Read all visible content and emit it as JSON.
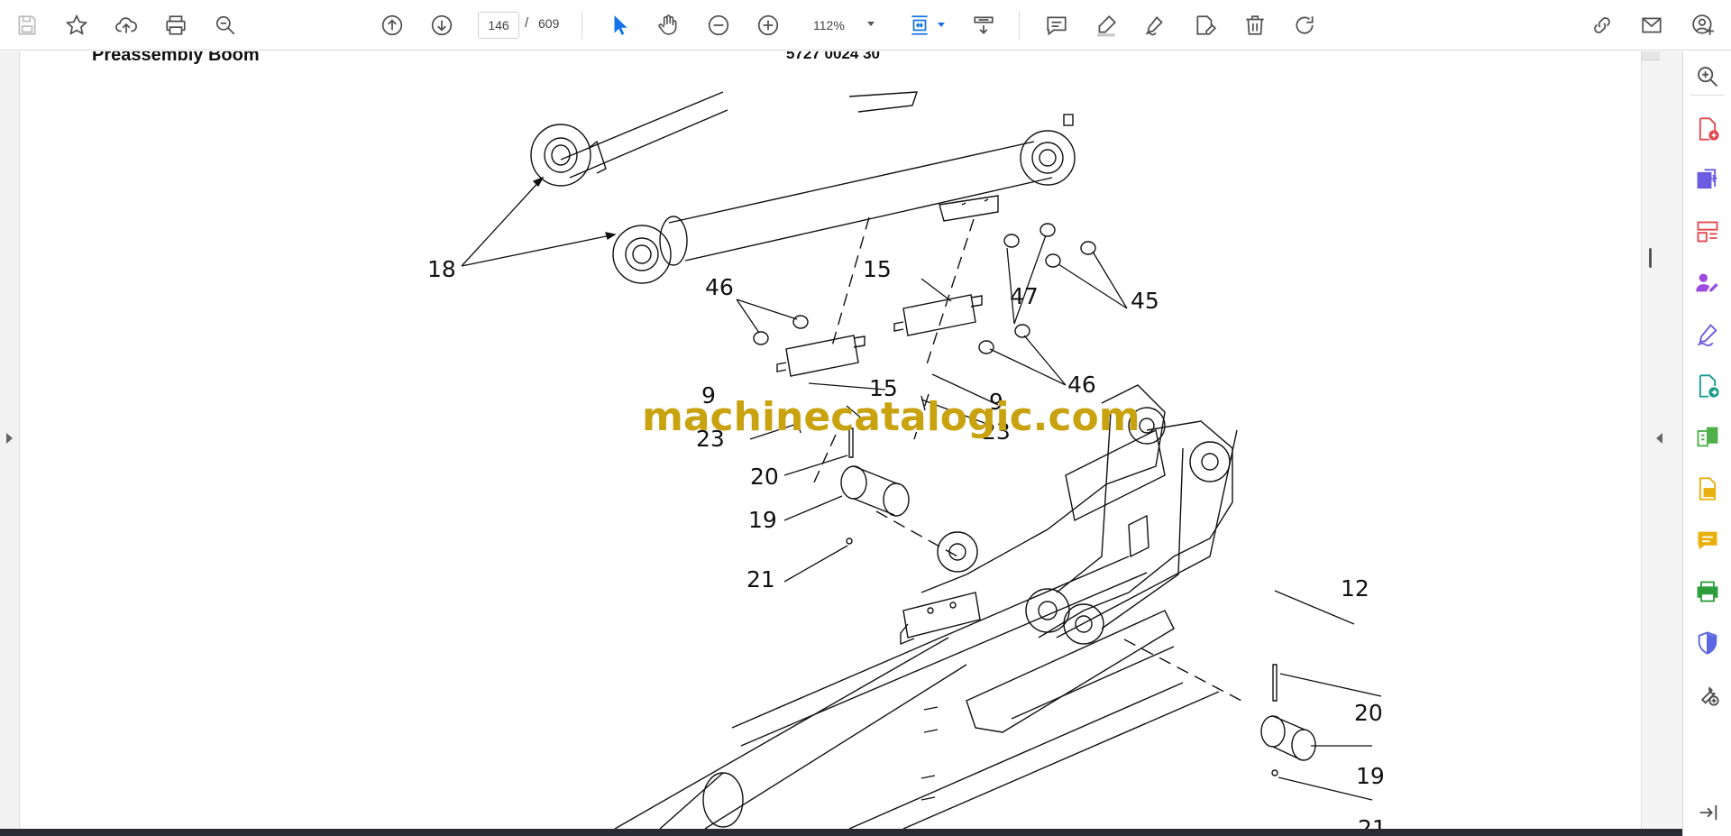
{
  "toolbar": {
    "current_page": "146",
    "page_separator": "/",
    "total_pages": "609",
    "zoom": "112%",
    "colors": {
      "icon": "#505050",
      "active": "#1473e6",
      "sign": "#505050"
    }
  },
  "document": {
    "title": "Preassembly Boom",
    "part_number": "5727 0024 30",
    "watermark": "machinecatalogic.com",
    "callouts": [
      "18",
      "46",
      "15",
      "47",
      "45",
      "46",
      "9",
      "15",
      "9",
      "23",
      "23",
      "20",
      "19",
      "21",
      "12",
      "20",
      "19",
      "21"
    ]
  },
  "sidebar": {
    "tools": [
      {
        "icon": "zoom-in-icon",
        "color": "#505050"
      },
      {
        "icon": "create-pdf-icon",
        "color": "#e34850"
      },
      {
        "icon": "export-pdf-icon",
        "color": "#6a5be2"
      },
      {
        "icon": "organize-pages-icon",
        "color": "#e34850"
      },
      {
        "icon": "request-signatures-icon",
        "color": "#9b4de0"
      },
      {
        "icon": "fill-sign-icon",
        "color": "#6a5be2"
      },
      {
        "icon": "edit-pdf-icon",
        "color": "#1a9a8c"
      },
      {
        "icon": "compare-files-icon",
        "color": "#4fb04a"
      },
      {
        "icon": "export-doc-icon",
        "color": "#e8b00c"
      },
      {
        "icon": "comment-icon",
        "color": "#e8b00c"
      },
      {
        "icon": "print-production-icon",
        "color": "#2d9d3c"
      },
      {
        "icon": "protect-icon",
        "color": "#5b67e0"
      },
      {
        "icon": "more-tools-icon",
        "color": "#505050"
      },
      {
        "icon": "collapse-panel-icon",
        "color": "#505050"
      }
    ]
  }
}
